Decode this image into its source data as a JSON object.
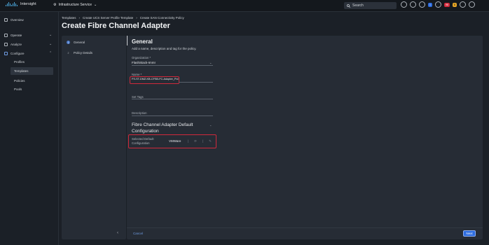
{
  "header": {
    "app_title": "Intersight",
    "service": "Infrastructure Service",
    "search_placeholder": "Search",
    "badges": {
      "notifications": "1",
      "alarms_critical": "98",
      "alarms_warning": "8"
    }
  },
  "sidebar": {
    "overview": "Overview",
    "operate": "Operate",
    "analyze": "Analyze",
    "configure": "Configure",
    "configure_items": [
      "Profiles",
      "Templates",
      "Policies",
      "Pools"
    ]
  },
  "breadcrumb": [
    "Templates",
    "Create UCS Server Profile Template",
    "Create SAN Connectivity Policy"
  ],
  "page_title": "Create Fibre Channel Adapter",
  "wizard": {
    "steps": [
      {
        "num": "1",
        "label": "General"
      },
      {
        "num": "2",
        "label": "Policy Details"
      }
    ]
  },
  "general": {
    "title": "General",
    "description": "Add a name, description and tag for the policy.",
    "organization_label": "Organization *",
    "organization_value": "FlashStack-ImmI",
    "name_label": "Name *",
    "name_value": "FS-ST-DMZ-KB-CFSB-FC-Adapter_Pol",
    "tags_label": "Set Tags",
    "description_label": "Description",
    "subsection_title": "Fibre Channel Adapter Default Configuration",
    "default_config_label": "Selected Default Configuration",
    "default_config_value": "VMWare",
    "config_icons": [
      "|",
      "⟳",
      "|",
      "✎"
    ]
  },
  "footer": {
    "cancel": "Cancel",
    "next": "Next"
  },
  "colors": {
    "accent": "#2d6cdf",
    "highlight": "#d0293b"
  }
}
